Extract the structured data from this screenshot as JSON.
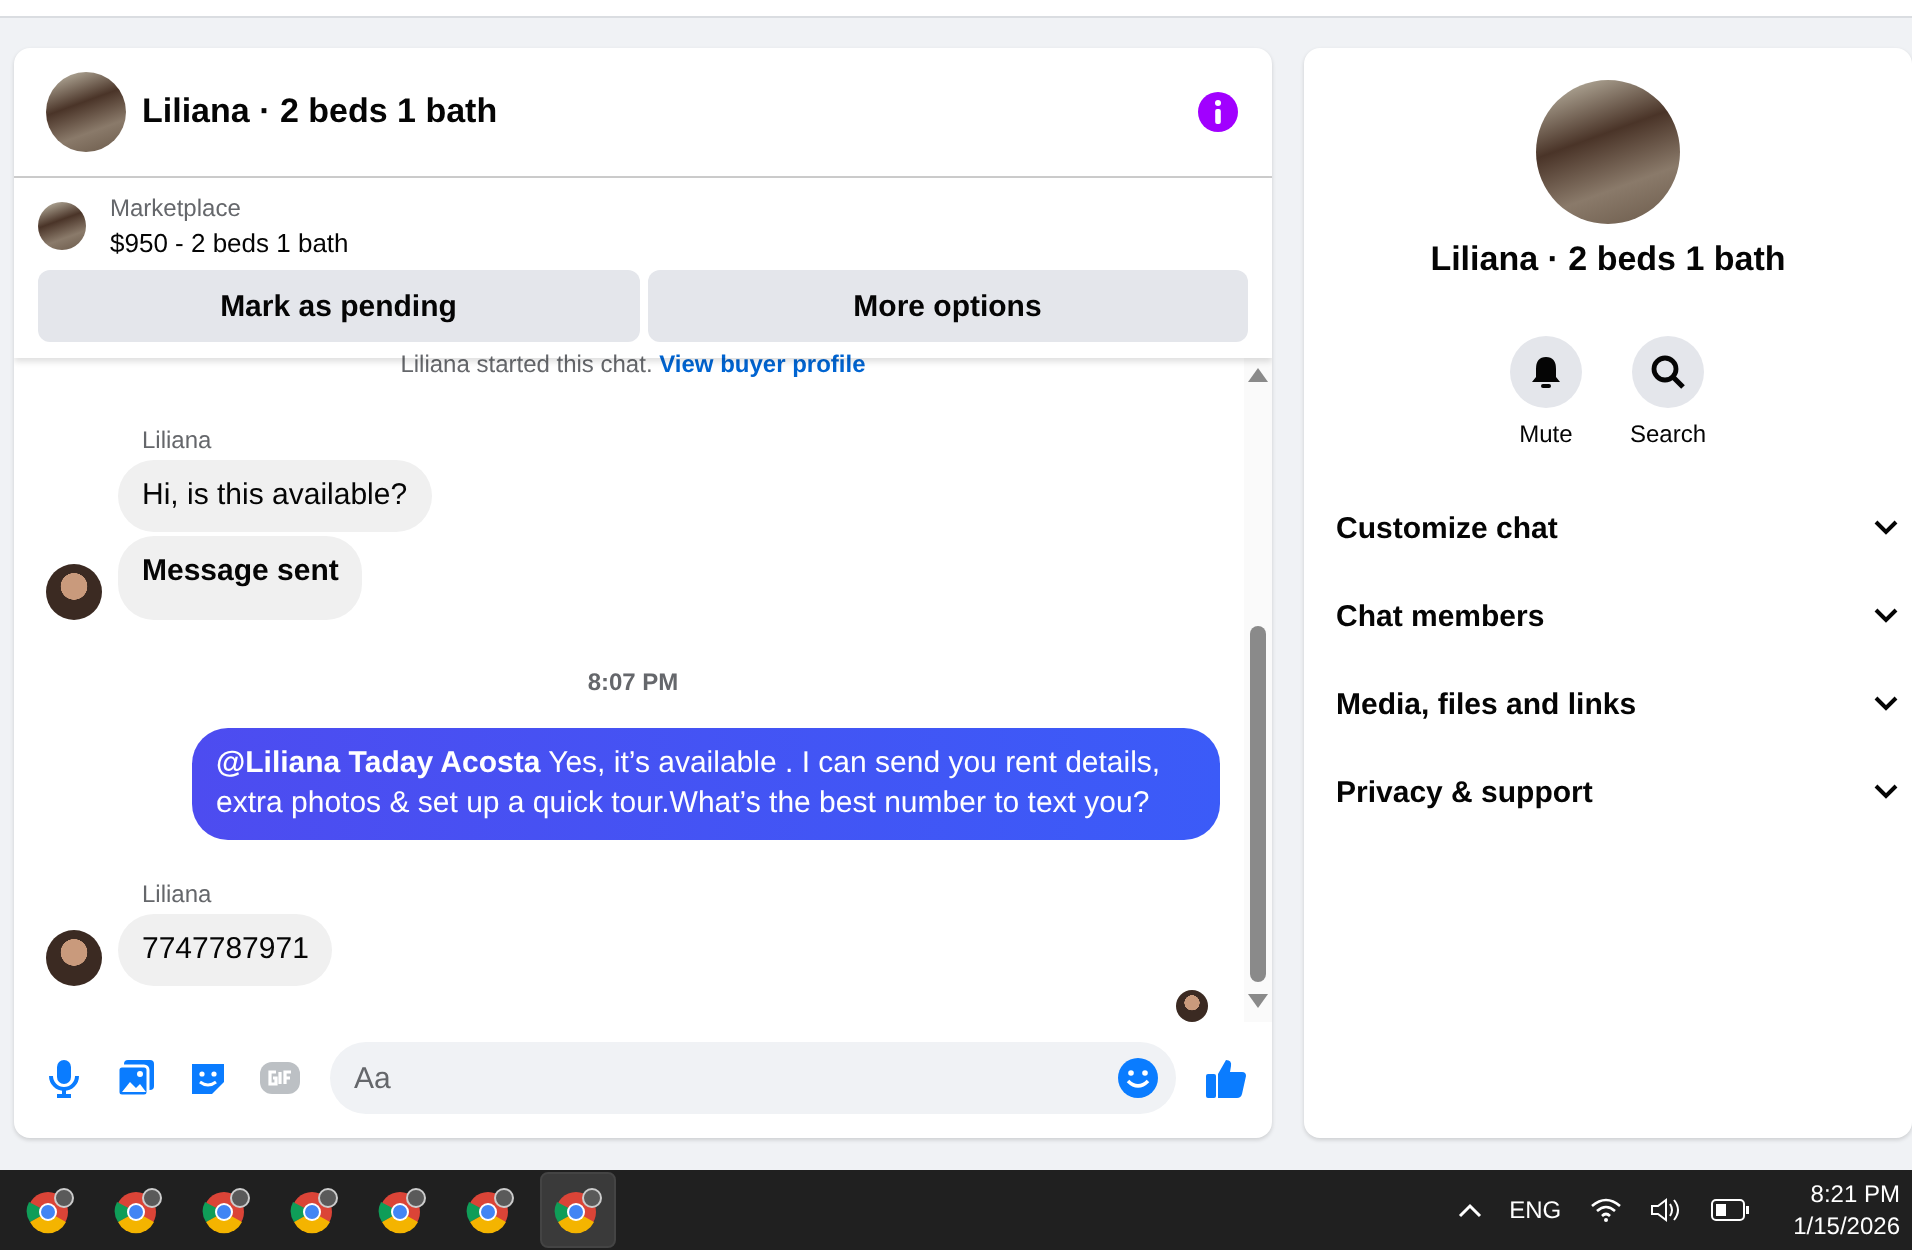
{
  "chat": {
    "title": "Liliana · 2 beds 1 bath",
    "listing": {
      "label": "Marketplace",
      "summary": "$950 - 2 beds 1 bath"
    },
    "actions": [
      "Mark as pending",
      "More options"
    ],
    "notice": {
      "text": "Liliana started this chat.",
      "link": "View buyer profile"
    },
    "messages": [
      {
        "kind": "sender",
        "text": "Liliana"
      },
      {
        "kind": "incoming",
        "text": "Hi, is this available?",
        "bold": false,
        "avatar": false
      },
      {
        "kind": "incoming",
        "text": "Message sent",
        "bold": true,
        "avatar": true
      },
      {
        "kind": "time",
        "text": "8:07 PM"
      },
      {
        "kind": "outgoing",
        "text": "**@Liliana Taday Acosta** Yes, it’s available .  I can send you rent details, extra photos & set up a quick tour.What’s the best number to text you?"
      },
      {
        "kind": "sender",
        "text": "Liliana"
      },
      {
        "kind": "incoming",
        "text": "7747787971",
        "bold": false,
        "avatar": true
      }
    ],
    "composer": {
      "placeholder": "Aa"
    }
  },
  "details": {
    "title": "Liliana · 2 beds 1 bath",
    "actions": [
      {
        "kind": "bell",
        "label": "Mute"
      },
      {
        "kind": "search",
        "label": "Search"
      }
    ],
    "sections": [
      {
        "label": "Customize chat",
        "expanded": false
      },
      {
        "label": "Chat members",
        "expanded": false
      },
      {
        "label": "Media, files and links",
        "expanded": false
      },
      {
        "label": "Privacy & support",
        "expanded": false
      }
    ]
  },
  "taskbar": {
    "apps": [
      {
        "selected": false
      },
      {
        "selected": false
      },
      {
        "selected": false
      },
      {
        "selected": false
      },
      {
        "selected": false
      },
      {
        "selected": false
      },
      {
        "selected": true
      }
    ],
    "language": "ENG",
    "time": "8:21 PM",
    "date": "1/15/2026"
  }
}
